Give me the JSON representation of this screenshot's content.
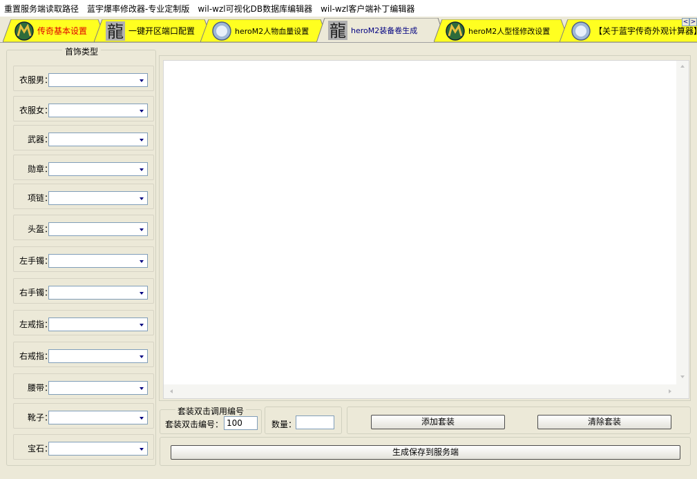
{
  "menu": [
    "重置服务端读取路径",
    "蓝宇爆率修改器-专业定制版",
    "wil-wzl可视化DB数据库编辑器",
    "wil-wzl客户端补丁编辑器"
  ],
  "tabs": [
    {
      "label": "传奇基本设置",
      "icon": "globe-m-icon"
    },
    {
      "label": "一键开区端口配置",
      "icon": "dragon-glyph-icon"
    },
    {
      "label": "heroM2人物血量设置",
      "icon": "crystal-ball-icon"
    },
    {
      "label": "heroM2装备卷生成",
      "icon": "dragon-glyph-icon"
    },
    {
      "label": "heroM2人型怪修改设置",
      "icon": "globe-m-icon"
    },
    {
      "label": "【关于蓝宇传奇外观计算器】",
      "icon": "crystal-ball-icon"
    }
  ],
  "tab_nav": {
    "prev": "<",
    "next": ">"
  },
  "jewelry_group": {
    "title": "首饰类型",
    "fields": [
      {
        "label": "衣服男：",
        "value": ""
      },
      {
        "label": "衣服女：",
        "value": ""
      },
      {
        "label": "武器：",
        "value": ""
      },
      {
        "label": "勋章：",
        "value": ""
      },
      {
        "label": "项链：",
        "value": ""
      },
      {
        "label": "头盔：",
        "value": ""
      },
      {
        "label": "左手镯：",
        "value": ""
      },
      {
        "label": "右手镯：",
        "value": ""
      },
      {
        "label": "左戒指：",
        "value": ""
      },
      {
        "label": "右戒指：",
        "value": ""
      },
      {
        "label": "腰带：",
        "value": ""
      },
      {
        "label": "靴子：",
        "value": ""
      },
      {
        "label": "宝石：",
        "value": ""
      }
    ]
  },
  "output_text": "",
  "suit_group": {
    "title": "套装双击调用编号",
    "label": "套装双击编号：",
    "value": "100"
  },
  "qty": {
    "label": "数量：",
    "value": ""
  },
  "buttons": {
    "add": "添加套装",
    "clear": "清除套装",
    "generate": "生成保存到服务端"
  }
}
